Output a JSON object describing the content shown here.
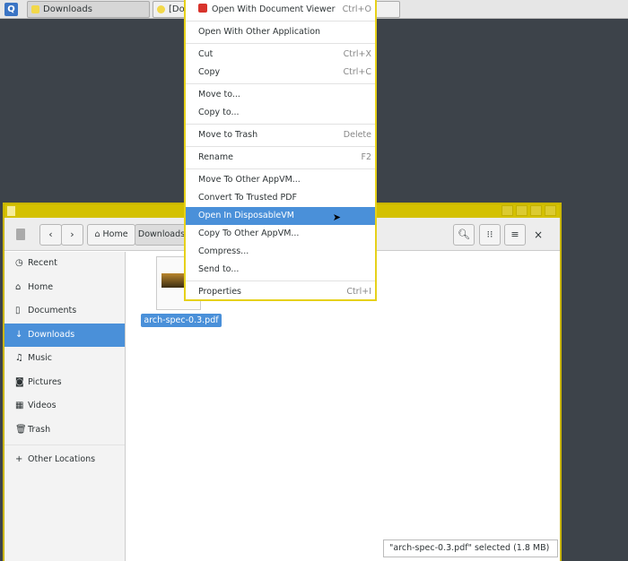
{
  "taskbar": {
    "logo": "Q",
    "tabs": [
      {
        "label": "Downloads"
      },
      {
        "label": "[Do"
      }
    ]
  },
  "context_menu": {
    "items": [
      {
        "label": "Open With Document Viewer",
        "shortcut": "Ctrl+O",
        "icon": "pdf-icon"
      },
      {
        "sep": true
      },
      {
        "label": "Open With Other Application"
      },
      {
        "sep": true
      },
      {
        "label": "Cut",
        "shortcut": "Ctrl+X"
      },
      {
        "label": "Copy",
        "shortcut": "Ctrl+C"
      },
      {
        "sep": true
      },
      {
        "label": "Move to..."
      },
      {
        "label": "Copy to..."
      },
      {
        "sep": true
      },
      {
        "label": "Move to Trash",
        "shortcut": "Delete"
      },
      {
        "sep": true
      },
      {
        "label": "Rename",
        "shortcut": "F2"
      },
      {
        "sep": true
      },
      {
        "label": "Move To Other AppVM..."
      },
      {
        "label": "Convert To Trusted PDF"
      },
      {
        "label": "Open In DisposableVM",
        "highlighted": true
      },
      {
        "label": "Copy To Other AppVM..."
      },
      {
        "label": "Compress..."
      },
      {
        "label": "Send to..."
      },
      {
        "sep": true
      },
      {
        "label": "Properties",
        "shortcut": "Ctrl+I"
      }
    ]
  },
  "window": {
    "path": {
      "home": "Home",
      "current": "Downloads"
    },
    "sidebar": [
      {
        "label": "Recent",
        "icon": "clock-icon"
      },
      {
        "label": "Home",
        "icon": "home-icon"
      },
      {
        "label": "Documents",
        "icon": "document-icon"
      },
      {
        "label": "Downloads",
        "icon": "download-icon",
        "selected": true
      },
      {
        "label": "Music",
        "icon": "music-icon"
      },
      {
        "label": "Pictures",
        "icon": "camera-icon"
      },
      {
        "label": "Videos",
        "icon": "film-icon"
      },
      {
        "label": "Trash",
        "icon": "trash-icon"
      },
      {
        "label": "Other Locations",
        "icon": "plus-icon"
      }
    ],
    "file": {
      "name": "arch-spec-0.3.pdf"
    },
    "status": "\"arch-spec-0.3.pdf\" selected  (1.8 MB)"
  },
  "colors": {
    "accent": "#4a90d9",
    "window_border": "#d4c100"
  }
}
